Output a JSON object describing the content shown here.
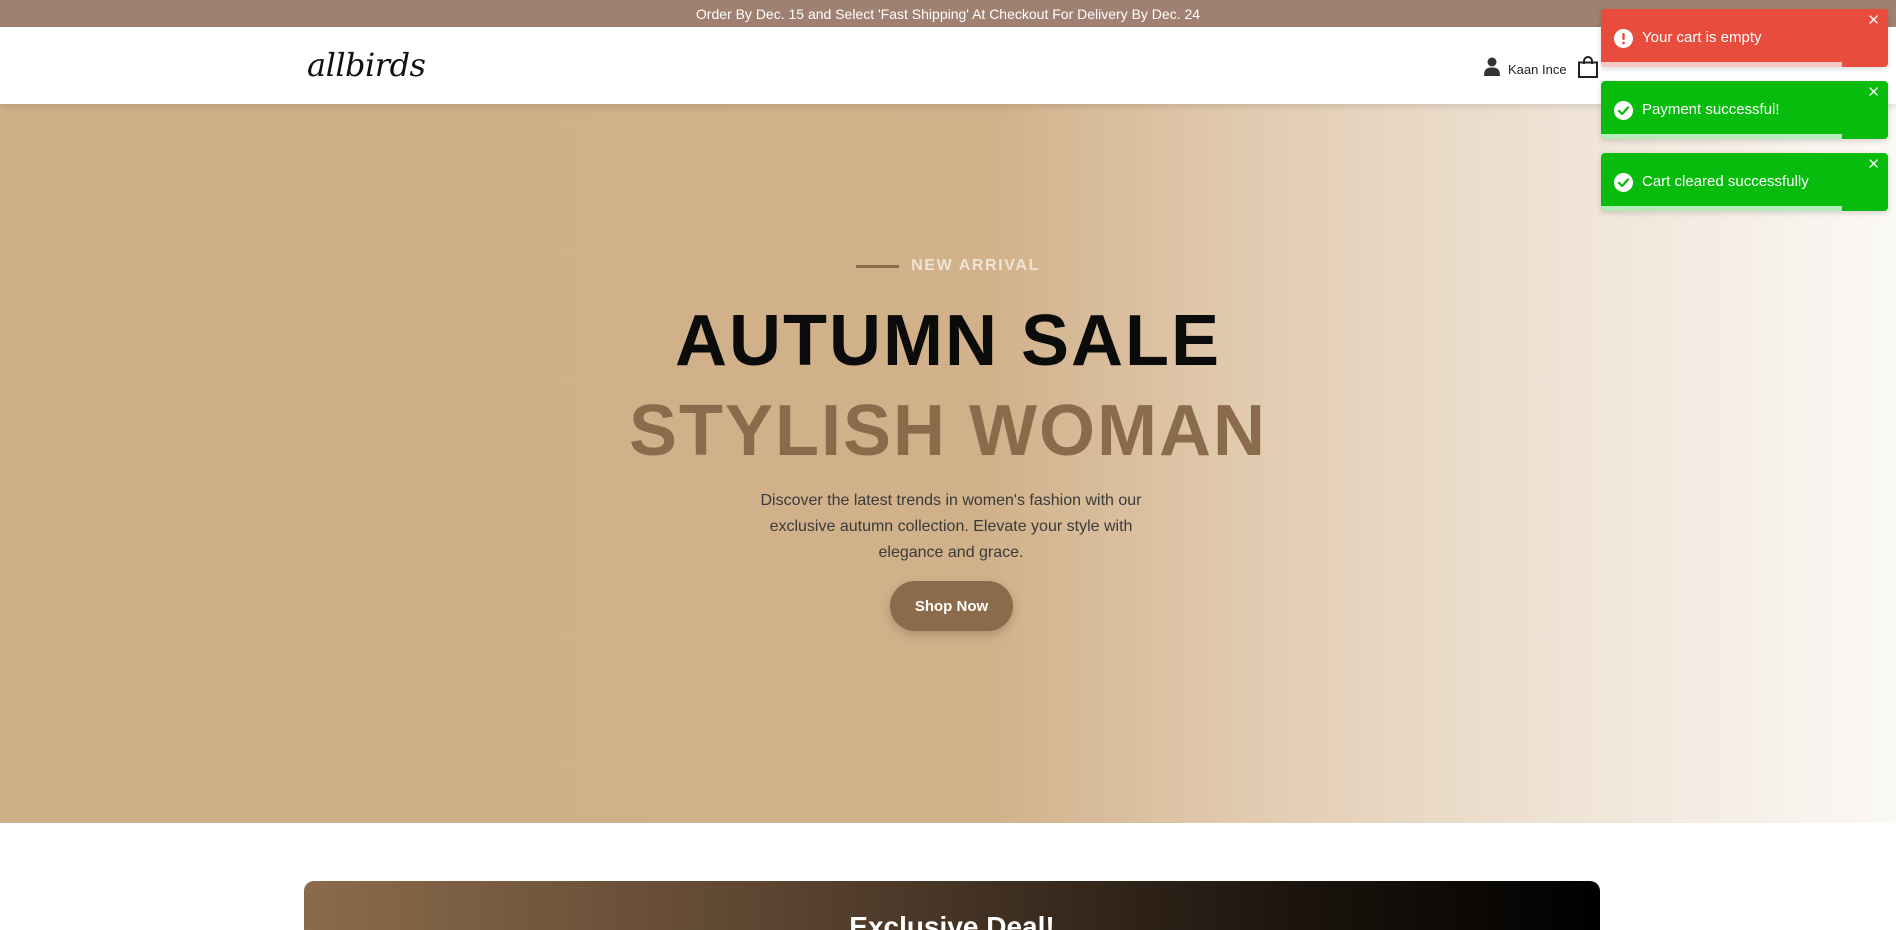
{
  "announcement": {
    "text": "Order By Dec. 15 and Select 'Fast Shipping' At Checkout For Delivery By Dec. 24"
  },
  "header": {
    "logo": "allbirds",
    "user_name": "Kaan Ince",
    "icons": [
      "user-icon",
      "shopping-bag-icon"
    ]
  },
  "hero": {
    "eyebrow": "NEW ARRIVAL",
    "title_line1": "AUTUMN SALE",
    "title_line2": "STYLISH WOMAN",
    "description": "Discover the latest trends in women's fashion with our exclusive autumn collection. Elevate your style with elegance and grace.",
    "cta_label": "Shop Now"
  },
  "deal": {
    "title": "Exclusive Deal!"
  },
  "toasts": [
    {
      "type": "error",
      "message": "Your cart is empty",
      "icon": "alert-icon",
      "progress": 0.84
    },
    {
      "type": "success",
      "message": "Payment successful!",
      "icon": "check-icon",
      "progress": 0.84
    },
    {
      "type": "success",
      "message": "Cart cleared successfully",
      "icon": "check-icon",
      "progress": 0.84
    }
  ],
  "colors": {
    "announcement_bg": "#a08070",
    "accent_brown": "#8b6b4b",
    "toast_error": "#e74c3c",
    "toast_success": "#07bc0c"
  }
}
